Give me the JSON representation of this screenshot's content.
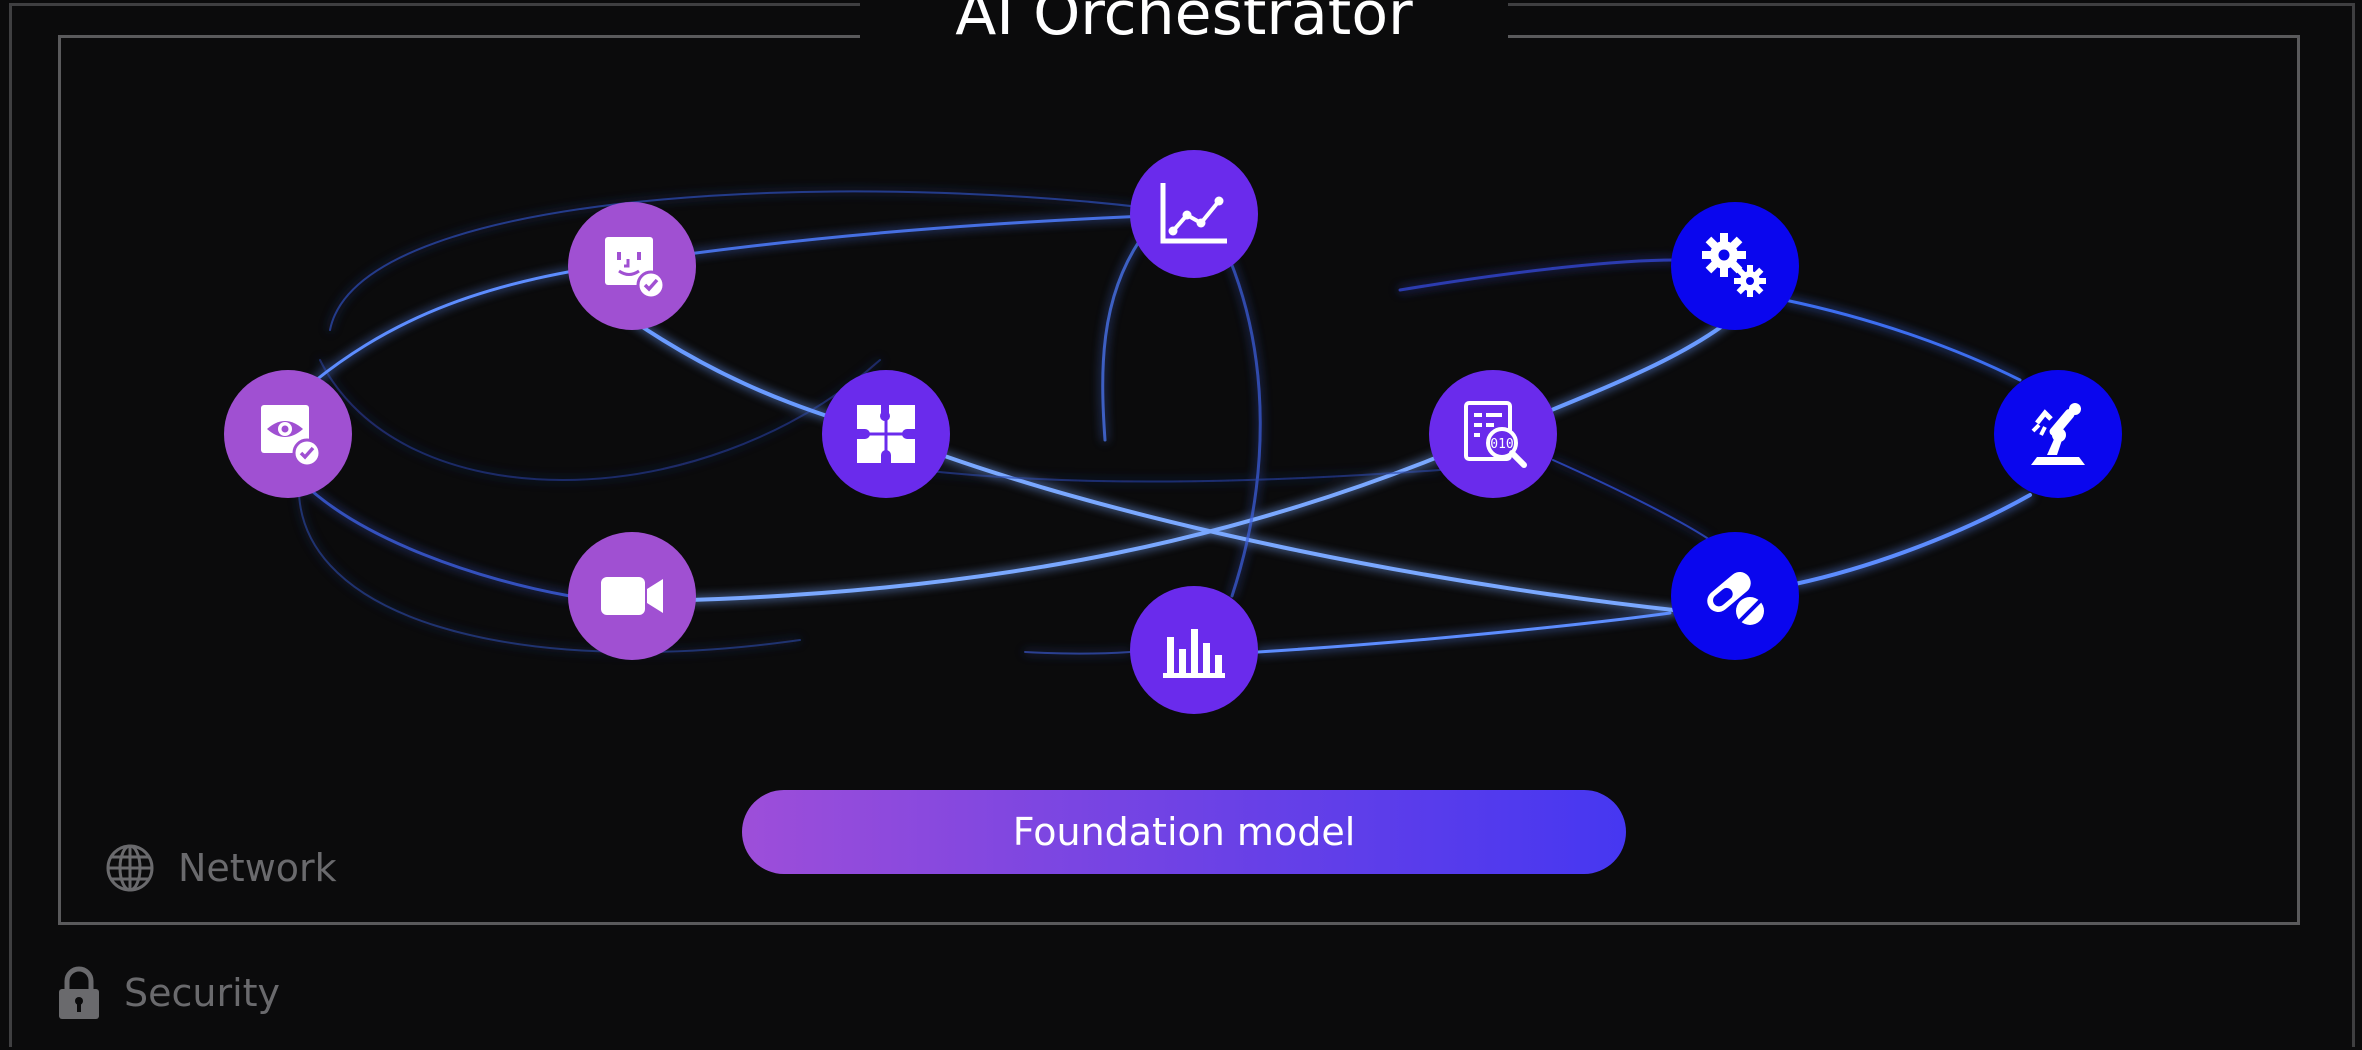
{
  "title": "AI Orchestrator",
  "foundation": {
    "label": "Foundation model"
  },
  "legend": {
    "network": {
      "label": "Network",
      "icon": "globe-icon"
    },
    "security": {
      "label": "Security",
      "icon": "padlock-icon"
    }
  },
  "nodes": [
    {
      "id": "face-check",
      "icon": "face-check-icon",
      "color": "#a050d2"
    },
    {
      "id": "eye-check",
      "icon": "eye-check-icon",
      "color": "#a050d2"
    },
    {
      "id": "video",
      "icon": "video-camera-icon",
      "color": "#a050d2"
    },
    {
      "id": "puzzle",
      "icon": "puzzle-icon",
      "color": "#6a2bec"
    },
    {
      "id": "line-chart",
      "icon": "line-chart-icon",
      "color": "#6a2bec"
    },
    {
      "id": "bar-chart",
      "icon": "bar-chart-icon",
      "color": "#6a2bec"
    },
    {
      "id": "data-search",
      "icon": "data-search-icon",
      "color": "#6a2bec"
    },
    {
      "id": "gears",
      "icon": "gears-icon",
      "color": "#0a06ee"
    },
    {
      "id": "robot-arm",
      "icon": "robot-arm-icon",
      "color": "#0a06ee"
    },
    {
      "id": "pills",
      "icon": "pills-icon",
      "color": "#0a06ee"
    }
  ],
  "colors": {
    "background": "#0b0b0c",
    "connection_glow": "#4d7dff",
    "node_purple": "#a050d2",
    "node_violet": "#6a2bec",
    "node_blue": "#0a06ee"
  }
}
